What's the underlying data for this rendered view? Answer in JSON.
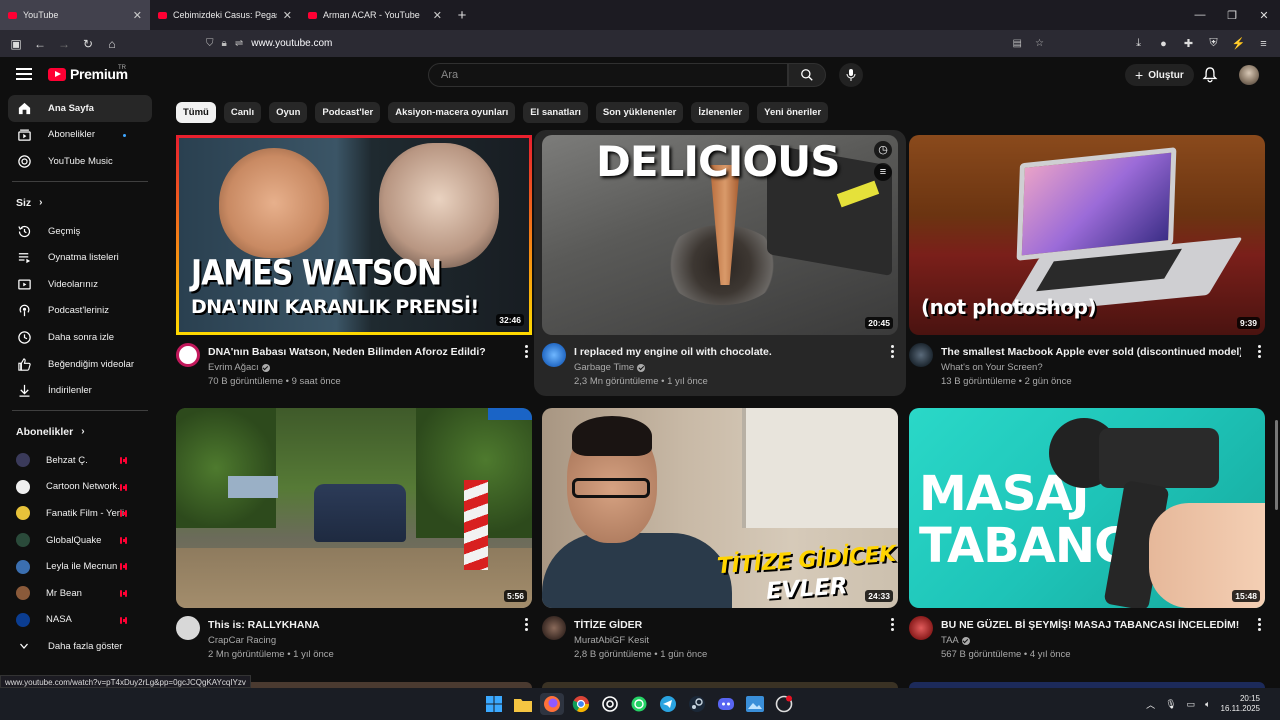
{
  "browser": {
    "tabs": [
      {
        "title": "YouTube",
        "active": true
      },
      {
        "title": "Cebimizdeki Casus: Pegasus Sk",
        "active": false
      },
      {
        "title": "Arman ACAR - YouTube",
        "active": false
      }
    ],
    "url": "www.youtube.com",
    "status_url": "www.youtube.com/watch?v=pT4xDuy2rLg&pp=0gcJCQgKAYcqIYzv"
  },
  "header": {
    "logo": "Premium",
    "country_code": "TR",
    "search_placeholder": "Ara",
    "create_label": "Oluştur"
  },
  "sidebar": {
    "main": [
      {
        "label": "Ana Sayfa",
        "icon": "home-icon",
        "active": true
      },
      {
        "label": "Abonelikler",
        "icon": "subscriptions-icon",
        "dot": true
      },
      {
        "label": "YouTube Music",
        "icon": "music-icon"
      }
    ],
    "you_heading": "Siz",
    "you": [
      {
        "label": "Geçmiş",
        "icon": "history-icon"
      },
      {
        "label": "Oynatma listeleri",
        "icon": "playlist-icon"
      },
      {
        "label": "Videolarınız",
        "icon": "your-videos-icon"
      },
      {
        "label": "Podcast'leriniz",
        "icon": "podcast-icon"
      },
      {
        "label": "Daha sonra izle",
        "icon": "watch-later-icon"
      },
      {
        "label": "Beğendiğim videolar",
        "icon": "like-icon"
      },
      {
        "label": "İndirilenler",
        "icon": "download-icon"
      }
    ],
    "subs_heading": "Abonelikler",
    "subscriptions": [
      {
        "label": "Behzat Ç.",
        "color": "#3a3a5a"
      },
      {
        "label": "Cartoon Network...",
        "color": "#eeeeee"
      },
      {
        "label": "Fanatik Film - Yerli",
        "color": "#e7c23a"
      },
      {
        "label": "GlobalQuake",
        "color": "#2a4a3a"
      },
      {
        "label": "Leyla ile Mecnun",
        "color": "#3b6fb0"
      },
      {
        "label": "Mr Bean",
        "color": "#8a5a3a"
      },
      {
        "label": "NASA",
        "color": "#0b3d91"
      }
    ],
    "more_label": "Daha fazla göster"
  },
  "chips": [
    "Tümü",
    "Canlı",
    "Oyun",
    "Podcast'ler",
    "Aksiyon-macera oyunları",
    "El sanatları",
    "Son yüklenenler",
    "İzlenenler",
    "Yeni öneriler"
  ],
  "videos": [
    {
      "title": "DNA'nın Babası Watson, Neden Bilimden Aforoz Edildi?",
      "channel": "Evrim Ağacı",
      "verified": true,
      "stats": "70 B görüntüleme • 9 saat önce",
      "duration": "32:46",
      "thumb_text1": "JAMES WATSON",
      "thumb_text2": "DNA'NIN KARANLIK PRENSİ!"
    },
    {
      "title": "I replaced my engine oil with chocolate.",
      "channel": "Garbage Time",
      "verified": true,
      "stats": "2,3 Mn görüntüleme • 1 yıl önce",
      "duration": "20:45",
      "thumb_text1": "DELICIOUS"
    },
    {
      "title": "The smallest Macbook Apple ever sold (discontinued model)",
      "channel": "What's on Your Screen?",
      "verified": false,
      "stats": "13 B görüntüleme • 2 gün önce",
      "duration": "9:39",
      "thumb_text1": "(not photoshop)"
    },
    {
      "title": "This is: RALLYKHANA",
      "channel": "CrapCar Racing",
      "verified": false,
      "stats": "2 Mn görüntüleme • 1 yıl önce",
      "duration": "5:56"
    },
    {
      "title": "TİTİZE GİDER",
      "channel": "MuratAbiGF Kesit",
      "verified": false,
      "stats": "2,8 B görüntüleme • 1 gün önce",
      "duration": "24:33",
      "thumb_text1": "TİTİZE GİDİCEK",
      "thumb_text2": "EVLER"
    },
    {
      "title": "BU NE GÜZEL Bİ ŞEYMİŞ! MASAJ TABANCASI İNCELEDİM!",
      "channel": "TAA",
      "verified": true,
      "stats": "567 B görüntüleme • 4 yıl önce",
      "duration": "15:48",
      "thumb_text1": "MASAJ",
      "thumb_text2": "TABANCASI"
    }
  ],
  "taskbar": {
    "time": "20:15",
    "date": "16.11.2025"
  }
}
